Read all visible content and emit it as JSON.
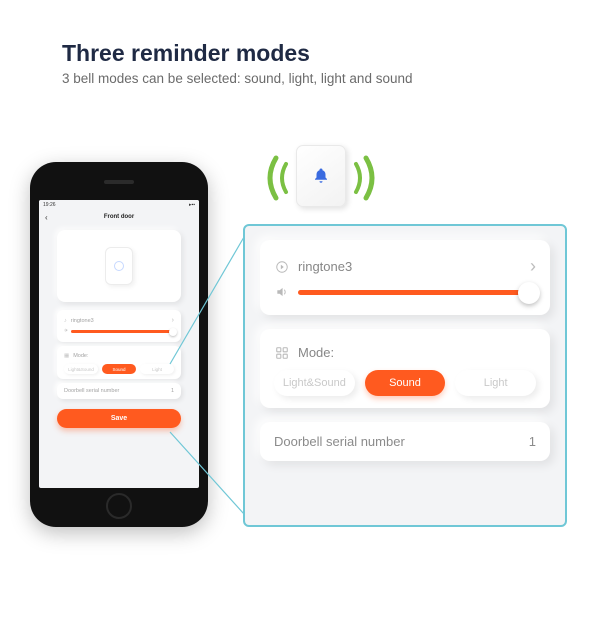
{
  "heading": "Three reminder modes",
  "subheading": "3 bell modes can be selected: sound, light, light and sound",
  "phone": {
    "status_time": "19:26",
    "back": "‹",
    "title": "Front door",
    "ringtone_label": "ringtone3",
    "mode_label": "Mode:",
    "modes": {
      "light_sound": "Light&Sound",
      "sound": "Sound",
      "light": "Light"
    },
    "serial_label": "Doorbell serial number",
    "serial_value": "1",
    "save": "Save",
    "volume_percent": 90
  },
  "panel": {
    "ringtone_label": "ringtone3",
    "mode_label": "Mode:",
    "modes": {
      "light_sound": "Light&Sound",
      "sound": "Sound",
      "light": "Light"
    },
    "serial_label": "Doorbell serial number",
    "serial_value": "1",
    "volume_percent": 92
  },
  "colors": {
    "accent": "#ff5a1f",
    "panel_border": "#6fc7d6",
    "wave": "#7bc043"
  }
}
